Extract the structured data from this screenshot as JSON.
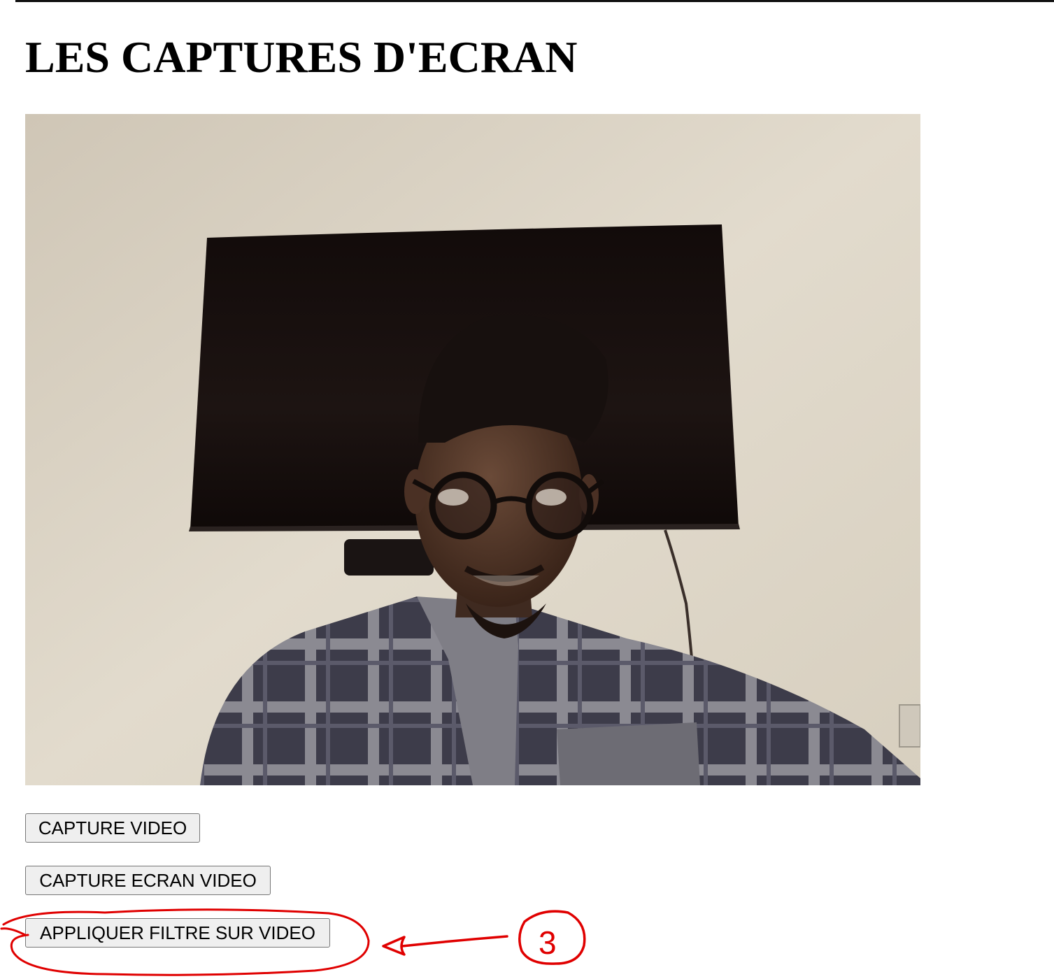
{
  "page": {
    "title": "LES CAPTURES D'ECRAN"
  },
  "video": {
    "icon": "webcam-video-frame",
    "colors": {
      "wall": "#d9d2c4",
      "tv": "#160f0d",
      "skin": "#4a3226",
      "shirt_dark": "#3b3a48",
      "shirt_light": "#8e8c92"
    }
  },
  "buttons": {
    "capture_video": "CAPTURE VIDEO",
    "capture_ecran_video": "CAPTURE ECRAN VIDEO",
    "appliquer_filtre": "APPLIQUER FILTRE SUR VIDEO"
  },
  "annotation": {
    "number": "3",
    "color": "#e00000"
  }
}
